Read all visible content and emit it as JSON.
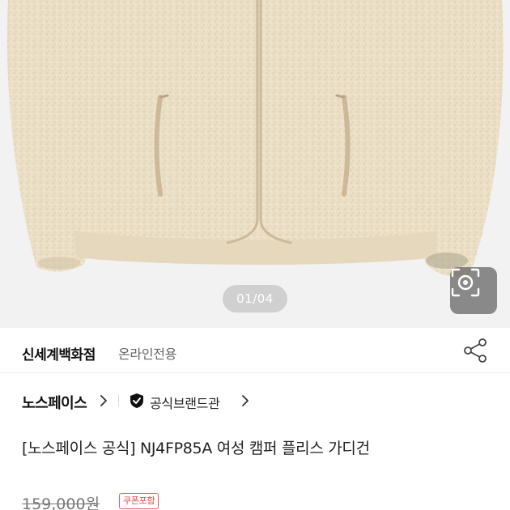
{
  "gallery": {
    "pager_text": "01/04",
    "product_image": "beige fleece zip-up jacket",
    "lens_icon": "camera-lens-icon"
  },
  "seller": {
    "name": "신세계백화점",
    "tag": "온라인전용",
    "share_icon": "share-icon"
  },
  "brand": {
    "name": "노스페이스",
    "official_label": "공식브랜드관",
    "official_icon": "shield-check-icon"
  },
  "product": {
    "title": "[노스페이스 공식] NJ4FP85A 여성 캠퍼 플리스 가디건"
  },
  "price": {
    "original": "159,000원",
    "coupon_badge": "쿠폰포함"
  },
  "colors": {
    "fleece": "#ebdfc6",
    "coupon": "#e24848"
  }
}
